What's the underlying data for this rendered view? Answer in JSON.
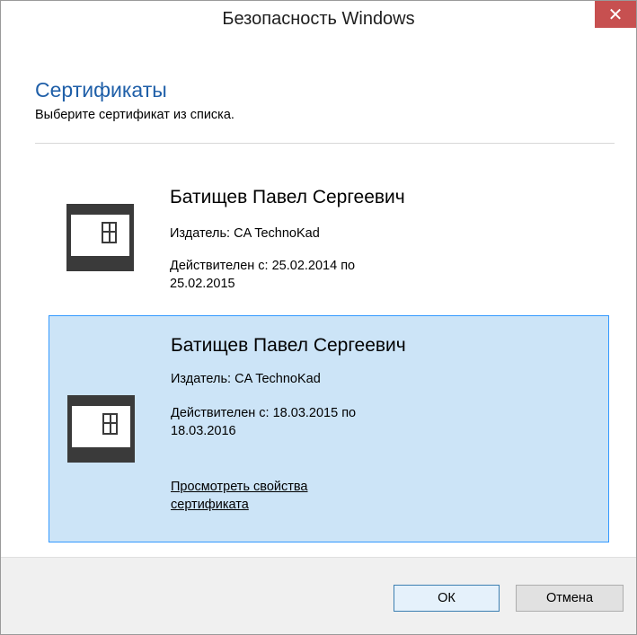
{
  "window": {
    "title": "Безопасность Windows",
    "close_glyph": "✕"
  },
  "header": {
    "title": "Сертификаты",
    "subtitle": "Выберите сертификат из списка."
  },
  "certificates": [
    {
      "name": "Батищев Павел Сергеевич",
      "issuer": "Издатель: CA TechnoKad",
      "valid_line1": "Действителен с: 25.02.2014 по",
      "valid_line2": "25.02.2015",
      "selected": false
    },
    {
      "name": "Батищев Павел Сергеевич",
      "issuer": "Издатель: CA TechnoKad",
      "valid_line1": "Действителен с: 18.03.2015 по",
      "valid_line2": "18.03.2016",
      "link_line1": "Просмотреть свойства",
      "link_line2": "сертификата",
      "selected": true
    }
  ],
  "icons": {
    "certificate": "certificate-card-icon",
    "close": "close-icon"
  },
  "buttons": {
    "ok": "ОК",
    "cancel": "Отмена"
  },
  "colors": {
    "accent_title": "#1f5fa8",
    "selection_bg": "#cce4f7",
    "selection_border": "#3399ff",
    "close_bg": "#c75050"
  }
}
